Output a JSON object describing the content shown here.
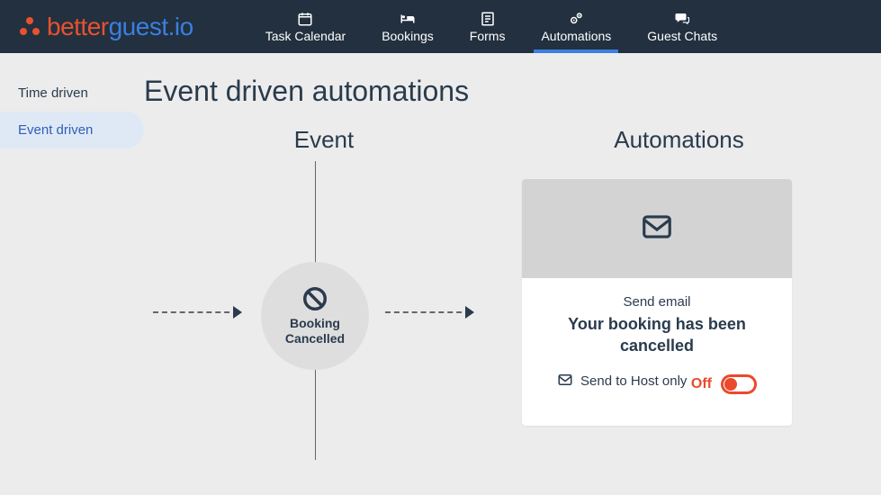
{
  "brand": {
    "part1": "better",
    "part2": "guest",
    "part3": ".io"
  },
  "nav": {
    "items": [
      {
        "label": "Task Calendar"
      },
      {
        "label": "Bookings"
      },
      {
        "label": "Forms"
      },
      {
        "label": "Automations"
      },
      {
        "label": "Guest Chats"
      }
    ]
  },
  "sidebar": {
    "items": [
      {
        "label": "Time driven"
      },
      {
        "label": "Event driven"
      }
    ]
  },
  "page": {
    "title": "Event driven automations",
    "col_event": "Event",
    "col_auto": "Automations"
  },
  "event": {
    "line1": "Booking",
    "line2": "Cancelled"
  },
  "automation": {
    "action": "Send email",
    "title": "Your booking has been cancelled",
    "recipient": "Send to Host only",
    "state_label": "Off",
    "state": "off",
    "colors": {
      "off": "#ea4a2b"
    }
  }
}
